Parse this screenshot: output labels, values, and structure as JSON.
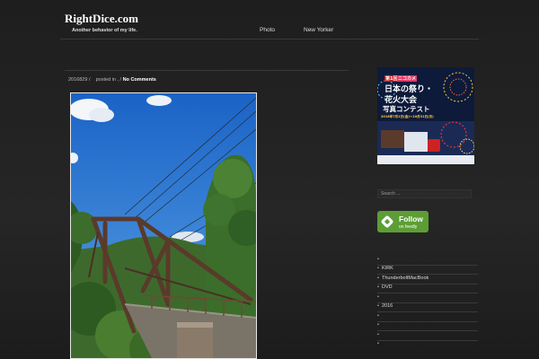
{
  "site": {
    "title": "RightDice.com",
    "tagline": "Another behavior of my life."
  },
  "nav": {
    "items": [
      {
        "label": "Photo"
      },
      {
        "label": "New Yorker"
      }
    ]
  },
  "post": {
    "date": "2016829 /",
    "posted_in": "posted in ,",
    "separator": "/",
    "comments": "No Comments"
  },
  "banner": {
    "badge_left": "第1回",
    "badge_right": "ニコカメ",
    "line1": "日本の祭り・",
    "line2": "花火大会",
    "line3": "写真コンテスト",
    "dates": "2016年7月1日(金)～10月31日(月)"
  },
  "search": {
    "placeholder": "Search ..."
  },
  "feedly": {
    "main": "Follow",
    "sub": "on feedly"
  },
  "sidebar": {
    "items": [
      {
        "bullet": "•",
        "label": ""
      },
      {
        "bullet": "•",
        "label": "KIRK"
      },
      {
        "bullet": "•",
        "label": "ThunderboltMacBook"
      },
      {
        "bullet": "•",
        "label": "DVD"
      },
      {
        "bullet": "•",
        "label": ""
      },
      {
        "bullet": "•",
        "label": "2016"
      },
      {
        "bullet": "•",
        "label": ""
      },
      {
        "bullet": "•",
        "label": ""
      },
      {
        "bullet": "•",
        "label": ""
      },
      {
        "bullet": "•",
        "label": ""
      }
    ]
  },
  "colors": {
    "background": "#1e1e1e",
    "feedly_green": "#5c9e35",
    "sky": "#1e6fd0"
  }
}
